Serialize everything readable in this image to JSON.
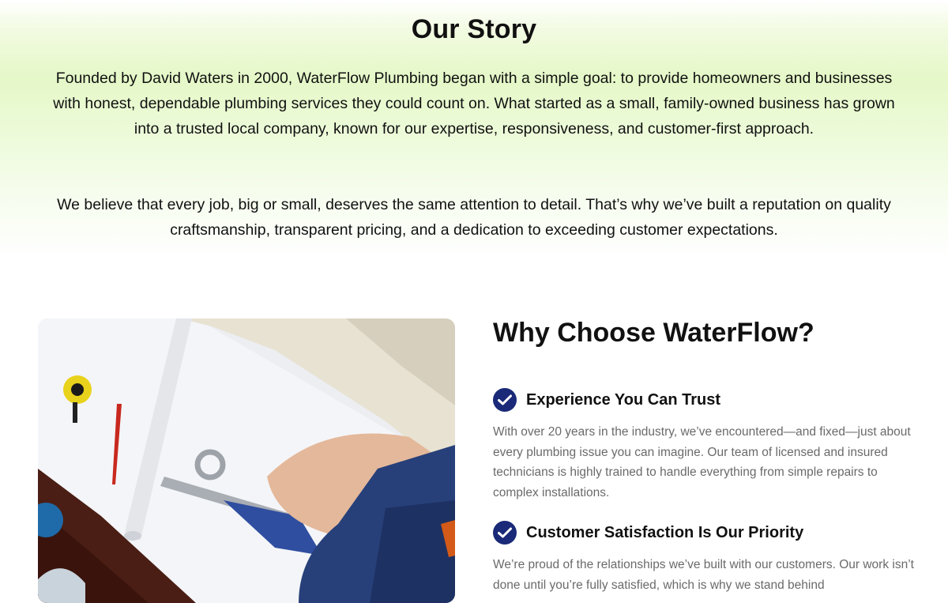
{
  "story": {
    "title": "Our Story",
    "paragraph1": "Founded by David Waters in 2000, WaterFlow Plumbing began with a simple goal: to provide homeowners and businesses with honest, dependable plumbing services they could count on. What started as a small, family-owned business has grown into a trusted local company, known for our expertise, responsiveness, and customer-first approach.",
    "paragraph2": "We believe that every job, big or small, deserves the same attention to detail. That’s why we’ve built a reputation on quality craftsmanship, transparent pricing, and a dedication to exceeding customer expectations."
  },
  "why": {
    "title": "Why Choose WaterFlow?",
    "features": [
      {
        "icon": "checkmark-circle-icon",
        "title": "Experience You Can Trust",
        "text": "With over 20 years in the industry, we’ve encountered—and fixed—just about every plumbing issue you can imagine. Our team of licensed and insured technicians is highly trained to handle everything from simple repairs to complex installations."
      },
      {
        "icon": "checkmark-circle-icon",
        "title": "Customer Satisfaction Is Our Priority",
        "text": "We’re proud of the relationships we’ve built with our customers. Our work isn’t done until you’re fully satisfied, which is why we stand behind"
      }
    ]
  },
  "colors": {
    "accent": "#1a2a78",
    "gradient": "#e5f8c8",
    "body_text": "#6a6a6a"
  }
}
